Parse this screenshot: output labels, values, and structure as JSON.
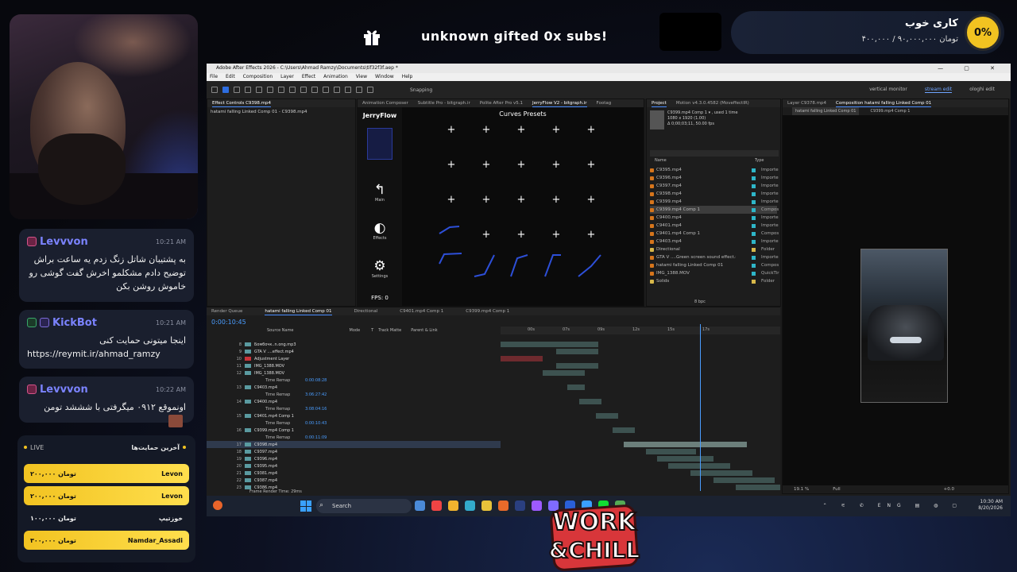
{
  "overlay": {
    "gift_text": "unknown gifted 0x subs!",
    "goal": {
      "percent": "0%",
      "title": "کاری خوب",
      "amount": "تومان ۹۰,۰۰۰,۰۰۰ / ۴۰۰,۰۰۰",
      "progress_fraction": 0
    },
    "accent_color": "#f2c321"
  },
  "chat": [
    {
      "user": "Levvvon",
      "time": "10:21 AM",
      "color": "#7b83ff",
      "badge": "pink",
      "text": "به پشتیبان شاتل زنگ زدم یه ساعت براش توضیح دادم مشکلمو اخرش گفت گوشی رو خاموش روشن بکن"
    },
    {
      "user": "KickBot",
      "time": "10:21 AM",
      "color": "#7b83ff",
      "badge": "green",
      "text": "اینجا میتونی حمایت کنی",
      "link": "https://reymit.ir/ahmad_ramzy"
    },
    {
      "user": "Levvvon",
      "time": "10:22 AM",
      "color": "#7b83ff",
      "badge": "pink",
      "text": "اونموقع ۰۹۱۲ میگرفتی با شششد تومن"
    }
  ],
  "donations": {
    "live_label": "LIVE",
    "title": "آخرین حمایت‌ها",
    "rows": [
      {
        "amount": "تومان ۲۰۰,۰۰۰",
        "user": "Levon",
        "style": "gold"
      },
      {
        "amount": "تومان ۲۰۰,۰۰۰",
        "user": "Levon",
        "style": "gold"
      },
      {
        "amount": "تومان ۱۰۰,۰۰۰",
        "user": "خوزتیپ",
        "style": "dark"
      },
      {
        "amount": "تومان ۳۰۰,۰۰۰",
        "user": "Namdar_Assadi",
        "style": "gold"
      }
    ]
  },
  "ae": {
    "title": "Adobe After Effects 2026 - C:\\Users\\Ahmad Ramzy\\Documents\\tif32f3f.aep *",
    "menu": [
      "File",
      "Edit",
      "Composition",
      "Layer",
      "Effect",
      "Animation",
      "View",
      "Window",
      "Help"
    ],
    "snapping": "Snapping",
    "workspaces": [
      "vertical monitor",
      "stream edit",
      "ologhi edit"
    ],
    "effect_controls_tab": "Effect Controls C9398.mp4",
    "effect_controls_sub": "hatami falling Linked Comp 01 - C9398.mp4",
    "center_tabs": [
      "Animation Composer",
      "Subtitle Pro - bitgraph.ir",
      "Polite After Pro v5.1",
      "JerryFlow V2 - bitgraph.ir",
      "Footag"
    ],
    "jerryflow": {
      "logo": "JerryFlow",
      "title": "Curves Presets",
      "main": "Main",
      "effects": "Effects",
      "settings": "Settings",
      "fps": "FPS: 0"
    },
    "project": {
      "tabs": [
        "Project",
        "Motion v4.3.0.4582 (MoveffectIR)"
      ],
      "info": [
        "C9399.mp4 Comp 1 ▾ , used 1 time",
        "1080 x 1920 (1.00)",
        "Δ 0;00;03;11, 50.00 fps"
      ],
      "col_name": "Name",
      "col_type": "Type",
      "bpc": "8 bpc",
      "items": [
        {
          "name": "C9395.mp4",
          "type": "Importe",
          "kind": "v"
        },
        {
          "name": "C9396.mp4",
          "type": "Importe",
          "kind": "v"
        },
        {
          "name": "C9397.mp4",
          "type": "Importe",
          "kind": "v"
        },
        {
          "name": "C9398.mp4",
          "type": "Importe",
          "kind": "v"
        },
        {
          "name": "C9399.mp4",
          "type": "Importe",
          "kind": "v"
        },
        {
          "name": "C9399.mp4 Comp 1",
          "type": "Compos",
          "kind": "c",
          "selected": true
        },
        {
          "name": "C9400.mp4",
          "type": "Importe",
          "kind": "v"
        },
        {
          "name": "C9401.mp4",
          "type": "Importe",
          "kind": "v"
        },
        {
          "name": "C9401.mp4 Comp 1",
          "type": "Compos",
          "kind": "c"
        },
        {
          "name": "C9403.mp4",
          "type": "Importe",
          "kind": "v"
        },
        {
          "name": "Directional",
          "type": "Folder",
          "kind": "f"
        },
        {
          "name": "GTA V ....Green screen sound effect.mp4",
          "type": "Importe",
          "kind": "v"
        },
        {
          "name": "hatami falling Linked Comp 01",
          "type": "Compos",
          "kind": "c"
        },
        {
          "name": "IMG_1388.MOV",
          "type": "QuickTir",
          "kind": "v"
        },
        {
          "name": "Solids",
          "type": "Folder",
          "kind": "f"
        }
      ]
    },
    "viewer": {
      "tabs": [
        "Layer C9378.mp4",
        "Composition hatami falling Linked Comp 01"
      ],
      "subtabs": [
        "hatami falling Linked Comp 01",
        "C9399.mp4 Comp 1"
      ],
      "zoom": "19.1 %",
      "quality": "Full",
      "offset": "+0.0"
    },
    "timeline": {
      "tabs": [
        "Render Queue",
        "hatami falling Linked Comp 01",
        "Directional",
        "C9401.mp4 Comp 1",
        "C9399.mp4 Comp 1"
      ],
      "timecode": "0:00:10:45",
      "frame_render": "Frame Render Time: 29ms",
      "ticks": [
        "00s",
        "07s",
        "09s",
        "12s",
        "15s",
        "17s"
      ],
      "headers": [
        "Source Name",
        "Mode",
        "T",
        "Track Matte",
        "Parent & Link"
      ],
      "layers": [
        {
          "num": "8",
          "name": "Бомбочк..n.ong.mp3",
          "sub": false
        },
        {
          "num": "9",
          "name": "GTA V ....effect.mp4",
          "sub": false
        },
        {
          "num": "10",
          "name": "Adjustment Layer",
          "sub": false,
          "red": true
        },
        {
          "num": "11",
          "name": "IMG_1388.MOV",
          "sub": false
        },
        {
          "num": "12",
          "name": "IMG_1388.MOV",
          "sub": false
        },
        {
          "num": "",
          "name": "Time Remap",
          "sub": true,
          "val": "0:00:08:28"
        },
        {
          "num": "13",
          "name": "C9403.mp4",
          "sub": false
        },
        {
          "num": "",
          "name": "Time Remap",
          "sub": true,
          "val": "3:06:27:42"
        },
        {
          "num": "14",
          "name": "C9400.mp4",
          "sub": false
        },
        {
          "num": "",
          "name": "Time Remap",
          "sub": true,
          "val": "3:08:04:16"
        },
        {
          "num": "15",
          "name": "C9401.mp4 Comp 1",
          "sub": false
        },
        {
          "num": "",
          "name": "Time Remap",
          "sub": true,
          "val": "0:00:10:43"
        },
        {
          "num": "16",
          "name": "C9399.mp4 Comp 1",
          "sub": false
        },
        {
          "num": "",
          "name": "Time Remap",
          "sub": true,
          "val": "0:00:11:09"
        },
        {
          "num": "17",
          "name": "C9398.mp4",
          "sub": false,
          "selected": true
        },
        {
          "num": "18",
          "name": "C9397.mp4",
          "sub": false
        },
        {
          "num": "19",
          "name": "C9396.mp4",
          "sub": false
        },
        {
          "num": "20",
          "name": "C9395.mp4",
          "sub": false
        },
        {
          "num": "21",
          "name": "C9381.mp4",
          "sub": false
        },
        {
          "num": "22",
          "name": "C9387.mp4",
          "sub": false
        },
        {
          "num": "23",
          "name": "C9386.mp4",
          "sub": false
        }
      ]
    }
  },
  "taskbar": {
    "search": "Search",
    "lang": "ENG",
    "time": "10:30 AM",
    "date": "8/20/2026"
  },
  "logo": {
    "line1": "WORK",
    "line2": "&CHILL"
  }
}
